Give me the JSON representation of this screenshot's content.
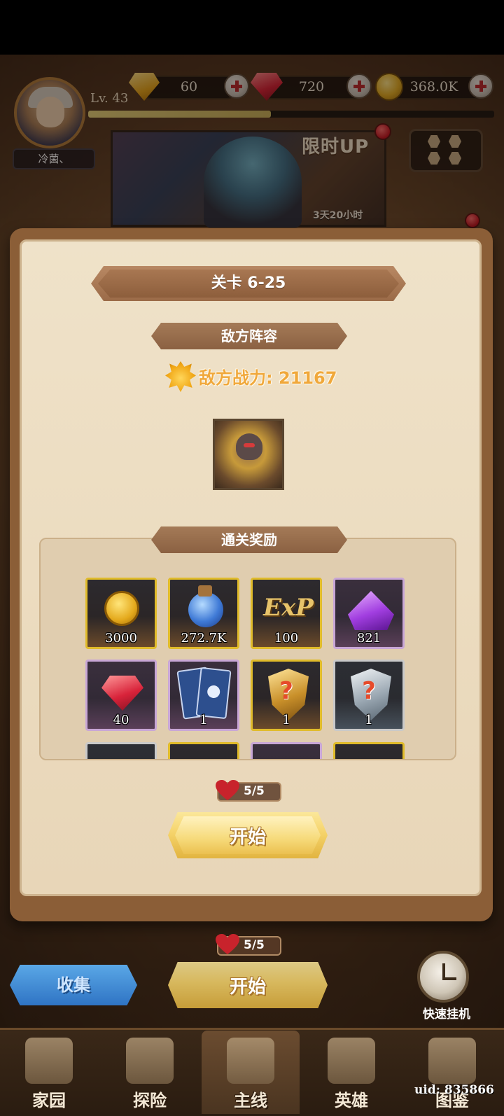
{
  "player": {
    "name": "冷菌、",
    "level": "Lv. 43",
    "exp_progress": 0.45
  },
  "currencies": [
    {
      "icon": "topaz-icon",
      "value": "60"
    },
    {
      "icon": "ruby-icon",
      "value": "720"
    },
    {
      "icon": "gold-coin-icon",
      "value": "368.0K"
    }
  ],
  "banner": {
    "title": "限时UP",
    "time_left": "3天20小时"
  },
  "stage": {
    "title": "关卡 6-25",
    "enemy_section": "敌方阵容",
    "enemy_power": "敌方战力: 21167",
    "reward_section": "通关奖励"
  },
  "rewards": [
    {
      "icon": "gold-coin-icon",
      "amount": "3000",
      "frame": "gold"
    },
    {
      "icon": "potion-icon",
      "amount": "272.7K",
      "frame": "gold"
    },
    {
      "icon": "exp-icon",
      "label": "ExP",
      "amount": "100",
      "frame": "gold"
    },
    {
      "icon": "purple-crystal-icon",
      "amount": "821",
      "frame": "purple"
    },
    {
      "icon": "ruby-icon",
      "amount": "40",
      "frame": "purple"
    },
    {
      "icon": "card-icon",
      "amount": "1",
      "frame": "purple"
    },
    {
      "icon": "mystery-shield-gold-icon",
      "amount": "1",
      "frame": "gold"
    },
    {
      "icon": "mystery-shield-silver-icon",
      "amount": "1",
      "frame": "grey"
    }
  ],
  "stamina": "5/5",
  "start_label": "开始",
  "collect_label": "收集",
  "idle_label": "快速挂机",
  "nav": [
    {
      "label": "家园",
      "active": false
    },
    {
      "label": "探险",
      "active": false
    },
    {
      "label": "主线",
      "active": true
    },
    {
      "label": "英雄",
      "active": false
    },
    {
      "label": "图鉴",
      "active": false
    }
  ],
  "uid": "uid: 835866",
  "colors": {
    "accent_gold": "#e0bb2a",
    "ribbon_brown": "#9b6b48",
    "heart_red": "#c8232c",
    "collect_blue": "#2f74c4"
  }
}
